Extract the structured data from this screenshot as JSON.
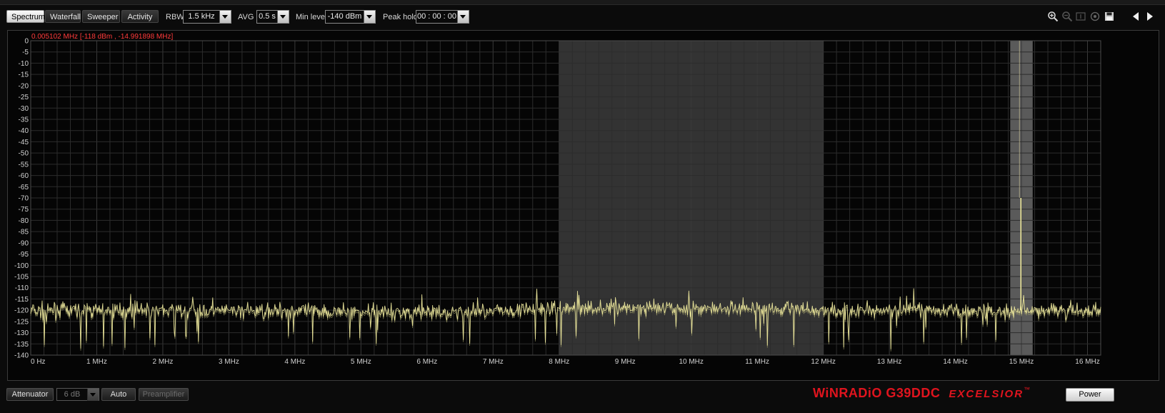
{
  "toolbar": {
    "tabs": [
      "Spectrum",
      "Waterfall",
      "Sweeper",
      "Activity"
    ],
    "active_tab": "Spectrum",
    "rbw": {
      "label": "RBW",
      "value": "1.5 kHz"
    },
    "avg": {
      "label": "AVG",
      "value": "0.5 s"
    },
    "min_level": {
      "label": "Min level",
      "value": "-140 dBm"
    },
    "peak_hold": {
      "label": "Peak hold",
      "value": "00 : 00 : 00"
    },
    "tools": [
      "zoom-in-icon",
      "zoom-out-icon",
      "zoom-reset-icon",
      "center-icon",
      "save-icon"
    ],
    "nav": [
      "left-arrow-icon",
      "right-arrow-icon"
    ]
  },
  "spectrum": {
    "cursor_readout": "0.005102 MHz [-118 dBm , -14.991898 MHz]",
    "colors": {
      "trace": "#f2eca0",
      "trace_dim": "#a39f6a",
      "grid": "#2c2c2c",
      "highlight_band": "#333333",
      "marker_band": "#5a5a5a",
      "readout": "#ff3a3a"
    }
  },
  "chart_data": {
    "type": "line",
    "title": "",
    "xlabel": "",
    "ylabel": "",
    "x_unit": "MHz",
    "xlim": [
      0,
      16.2
    ],
    "ylim": [
      -140,
      0
    ],
    "y_ticks": [
      0,
      -5,
      -10,
      -15,
      -20,
      -25,
      -30,
      -35,
      -40,
      -45,
      -50,
      -55,
      -60,
      -65,
      -70,
      -75,
      -80,
      -85,
      -90,
      -95,
      -100,
      -105,
      -110,
      -115,
      -120,
      -125,
      -130,
      -135,
      -140
    ],
    "x_ticks": [
      {
        "value": 0,
        "label": "0 Hz"
      },
      {
        "value": 1,
        "label": "1 MHz"
      },
      {
        "value": 2,
        "label": "2 MHz"
      },
      {
        "value": 3,
        "label": "3 MHz"
      },
      {
        "value": 4,
        "label": "4 MHz"
      },
      {
        "value": 5,
        "label": "5 MHz"
      },
      {
        "value": 6,
        "label": "6 MHz"
      },
      {
        "value": 7,
        "label": "7 MHz"
      },
      {
        "value": 8,
        "label": "8 MHz"
      },
      {
        "value": 9,
        "label": "9 MHz"
      },
      {
        "value": 10,
        "label": "10 MHz"
      },
      {
        "value": 11,
        "label": "11 MHz"
      },
      {
        "value": 12,
        "label": "12 MHz"
      },
      {
        "value": 13,
        "label": "13 MHz"
      },
      {
        "value": 14,
        "label": "14 MHz"
      },
      {
        "value": 15,
        "label": "15 MHz"
      },
      {
        "value": 16,
        "label": "16 MHz"
      }
    ],
    "highlight_band": [
      8.0,
      12.0
    ],
    "marker_band": [
      14.83,
      15.17
    ],
    "marker_freq": 14.991898,
    "noise_floor": -120,
    "series": [
      {
        "x": [
          0,
          2,
          4,
          6,
          8,
          9,
          10,
          11,
          12,
          14,
          14.99,
          15.2,
          16.2
        ],
        "y": [
          -120,
          -120,
          -120,
          -121,
          -119,
          -119,
          -119,
          -119,
          -120,
          -120,
          -70,
          -120,
          -120
        ]
      }
    ],
    "grid": true
  },
  "bottom": {
    "attenuator_label": "Attenuator",
    "attenuator_value": "6 dB",
    "auto_label": "Auto",
    "preamp_label": "Preamplifier",
    "brand_model": "WiNRADiO G39DDC",
    "brand_edition": "EXCELSIOR",
    "brand_tm": "™",
    "power_label": "Power"
  }
}
